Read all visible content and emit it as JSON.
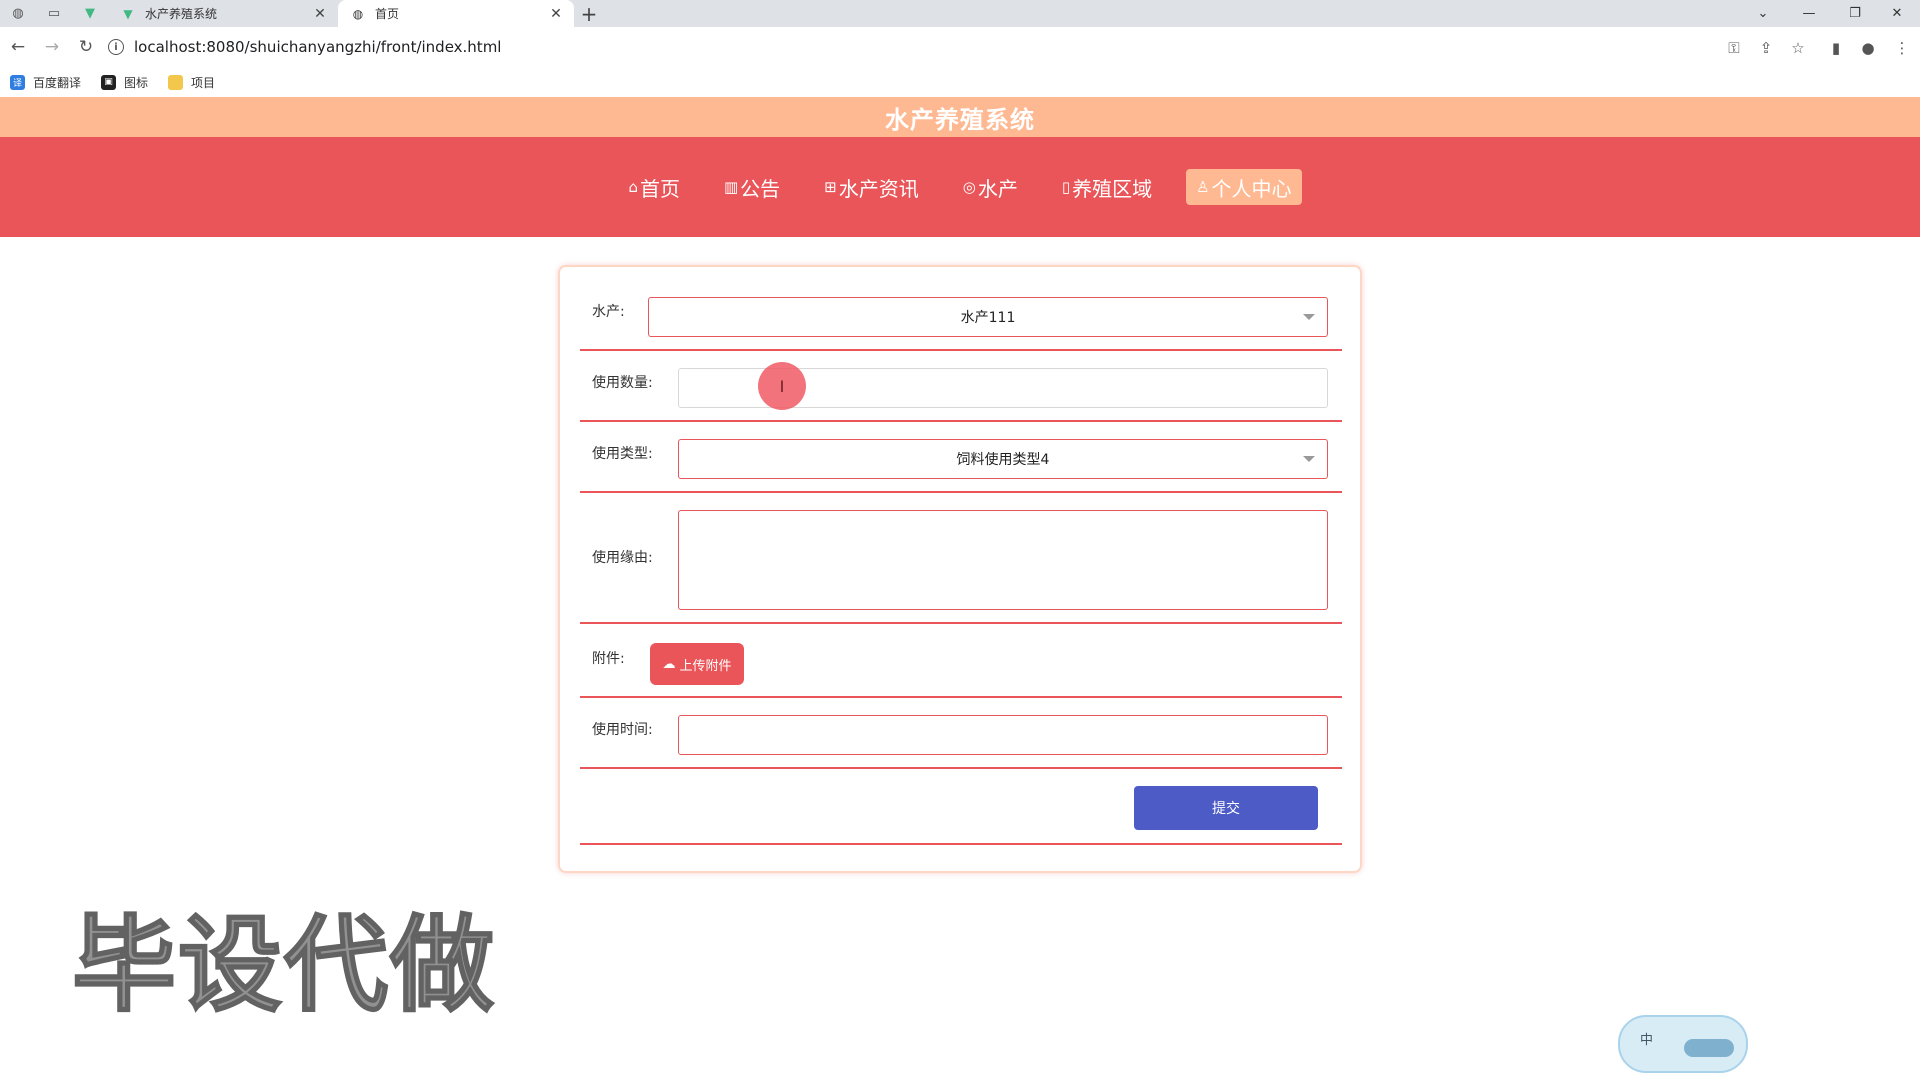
{
  "browser": {
    "tabs": [
      {
        "title": "水产养殖系统",
        "active": false
      },
      {
        "title": "首页",
        "active": true
      }
    ],
    "url": "localhost:8080/shuichanyangzhi/front/index.html",
    "bookmarks": [
      {
        "label": "百度翻译",
        "icon": "baidu-translate-icon"
      },
      {
        "label": "图标",
        "icon": "image-icon"
      },
      {
        "label": "项目",
        "icon": "folder-icon"
      }
    ]
  },
  "site": {
    "title": "水产养殖系统",
    "nav": [
      {
        "label": "首页",
        "icon": "home-icon",
        "active": false
      },
      {
        "label": "公告",
        "icon": "notice-icon",
        "active": false
      },
      {
        "label": "水产资讯",
        "icon": "news-icon",
        "active": false
      },
      {
        "label": "水产",
        "icon": "fish-icon",
        "active": false
      },
      {
        "label": "养殖区域",
        "icon": "area-icon",
        "active": false
      },
      {
        "label": "个人中心",
        "icon": "user-icon",
        "active": true
      }
    ]
  },
  "form": {
    "aquatic": {
      "label": "水产:",
      "value": "水产111"
    },
    "quantity": {
      "label": "使用数量:",
      "value": ""
    },
    "use_type": {
      "label": "使用类型:",
      "value": "饲料使用类型4"
    },
    "reason": {
      "label": "使用缘由:",
      "value": ""
    },
    "attachment": {
      "label": "附件:",
      "button": "上传附件"
    },
    "use_time": {
      "label": "使用时间:",
      "value": ""
    },
    "submit": "提交"
  },
  "watermark": "毕设代做",
  "ime": {
    "label": "中"
  },
  "colors": {
    "title_bar": "#ffb992",
    "nav_bar": "#e95558",
    "submit": "#4c5bc6",
    "accent": "#e95558"
  }
}
